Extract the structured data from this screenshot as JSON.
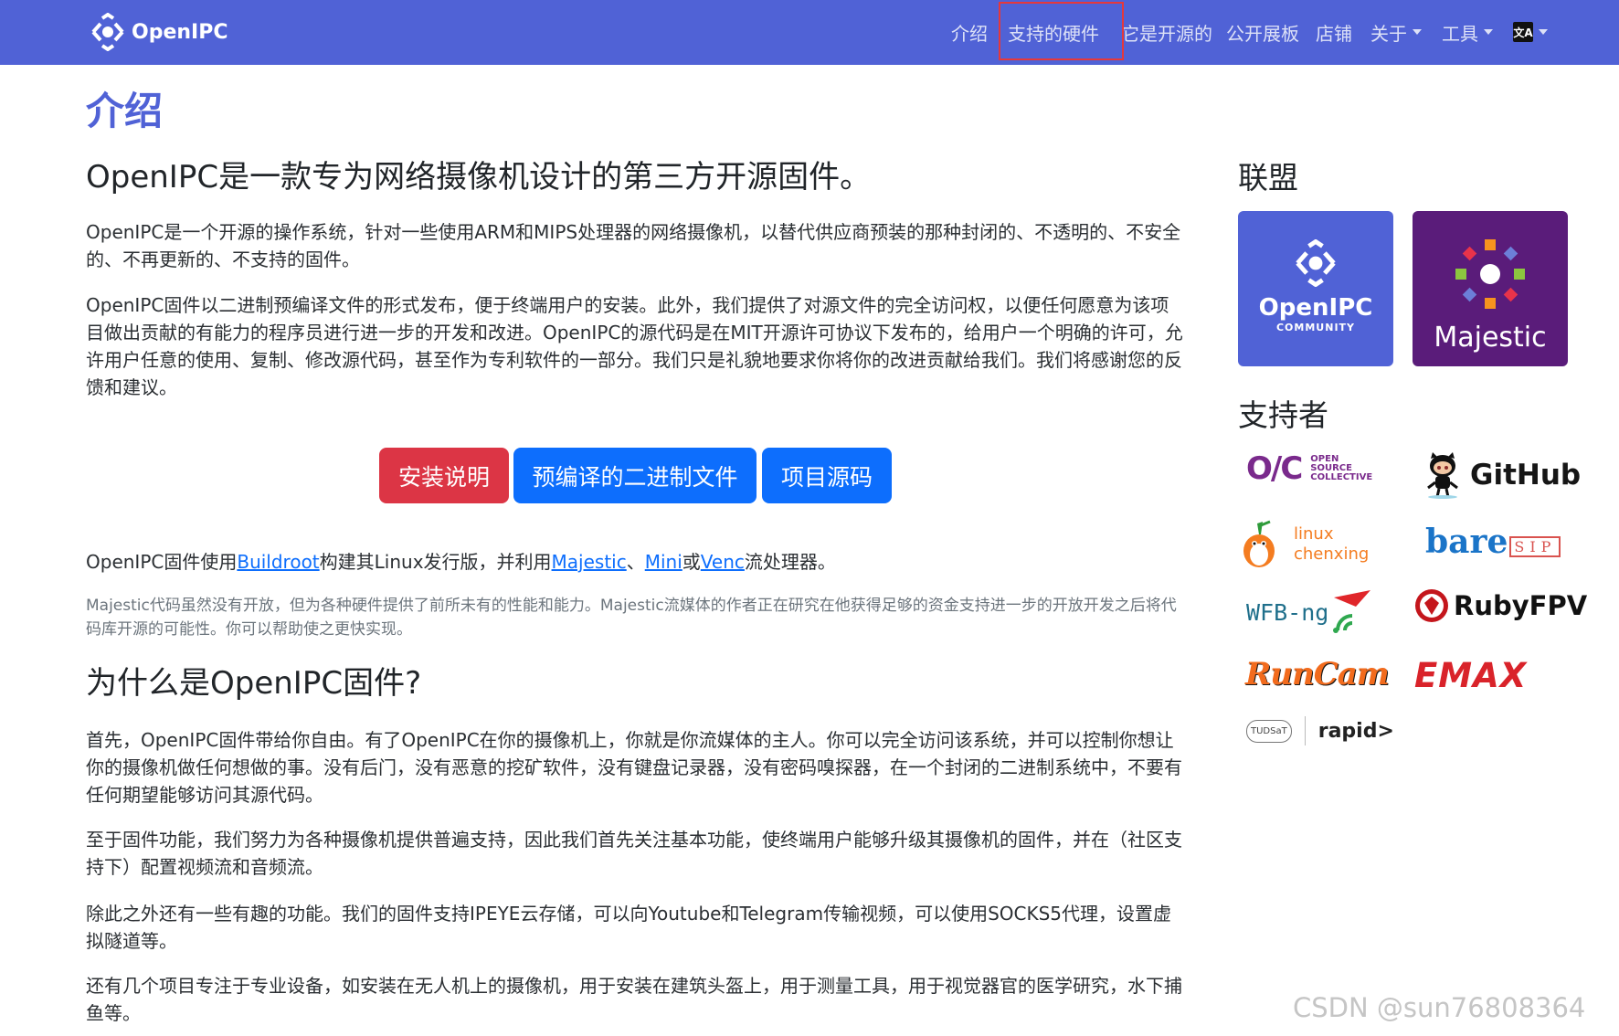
{
  "navbar": {
    "brand": "OpenIPC",
    "items": [
      {
        "label": "介绍",
        "dropdown": false
      },
      {
        "label": "支持的硬件",
        "dropdown": false,
        "highlighted": true
      },
      {
        "label": "它是开源的",
        "dropdown": false
      },
      {
        "label": "公开展板",
        "dropdown": false
      },
      {
        "label": "店铺",
        "dropdown": false
      },
      {
        "label": "关于",
        "dropdown": true
      },
      {
        "label": "工具",
        "dropdown": true
      }
    ],
    "language_icon": "translate-icon",
    "colors": {
      "background": "#5062d6",
      "highlight_border": "#e5383b"
    }
  },
  "main": {
    "title": "介绍",
    "lead": "OpenIPC是一款专为网络摄像机设计的第三方开源固件。",
    "para1": "OpenIPC是一个开源的操作系统，针对一些使用ARM和MIPS处理器的网络摄像机，以替代供应商预装的那种封闭的、不透明的、不安全的、不再更新的、不支持的固件。",
    "para2": "OpenIPC固件以二进制预编译文件的形式发布，便于终端用户的安装。此外，我们提供了对源文件的完全访问权，以便任何愿意为该项目做出贡献的有能力的程序员进行进一步的开发和改进。OpenIPC的源代码是在MIT开源许可协议下发布的，给用户一个明确的许可，允许用户任意的使用、复制、修改源代码，甚至作为专利软件的一部分。我们只是礼貌地要求你将你的改进贡献给我们。我们将感谢您的反馈和建议。",
    "buttons": {
      "install": "安装说明",
      "binaries": "预编译的二进制文件",
      "source": "项目源码"
    },
    "build_line": {
      "t1": "OpenIPC固件使用",
      "buildroot": "Buildroot",
      "t2": "构建其Linux发行版，并利用",
      "majestic": "Majestic",
      "sep": "、",
      "mini": "Mini",
      "or": "或",
      "venc": "Venc",
      "t3": "流处理器。"
    },
    "small_note": "Majestic代码虽然没有开放，但为各种硬件提供了前所未有的性能和能力。Majestic流媒体的作者正在研究在他获得足够的资金支持进一步的开放开发之后将代码库开源的可能性。你可以帮助使之更快实现。",
    "why_title": "为什么是OpenIPC固件?",
    "why1": "首先，OpenIPC固件带给你自由。有了OpenIPC在你的摄像机上，你就是你流媒体的主人。你可以完全访问该系统，并可以控制你想让你的摄像机做任何想做的事。没有后门，没有恶意的挖矿软件，没有键盘记录器，没有密码嗅探器，在一个封闭的二进制系统中，不要有任何期望能够访问其源代码。",
    "why2": "至于固件功能，我们努力为各种摄像机提供普遍支持，因此我们首先关注基本功能，使终端用户能够升级其摄像机的固件，并在（社区支持下）配置视频流和音频流。",
    "why3": "除此之外还有一些有趣的功能。我们的固件支持IPEYE云存储，可以向Youtube和Telegram传输视频，可以使用SOCKS5代理，设置虚拟隧道等。",
    "why4": "还有几个项目专注于专业设备，如安装在无人机上的摄像机，用于安装在建筑头盔上，用于测量工具，用于视觉器官的医学研究，水下捕鱼等。"
  },
  "sidebar": {
    "alliance_title": "联盟",
    "alliance": [
      {
        "name": "OpenIPC",
        "sub": "COMMUNITY",
        "color": "#5062d6"
      },
      {
        "name": "Majestic",
        "color": "#5a1c7a"
      }
    ],
    "supporters_title": "支持者",
    "supporters": {
      "osc_mark": "O/C",
      "osc_lines": [
        "OPEN",
        "SOURCE",
        "COLLECTIVE"
      ],
      "github": "GitHub",
      "linux_lines": [
        "linux",
        "chenxing"
      ],
      "baresip_a": "bare",
      "baresip_b": "SIP",
      "wfb": "WFB-ng",
      "rubyfpv": "RubyFPV",
      "runcam": "RunCam",
      "emax": "EMAX",
      "tudsat": "TUDSaT",
      "rapid": "rapid>"
    }
  },
  "watermark": "CSDN @sun76808364"
}
